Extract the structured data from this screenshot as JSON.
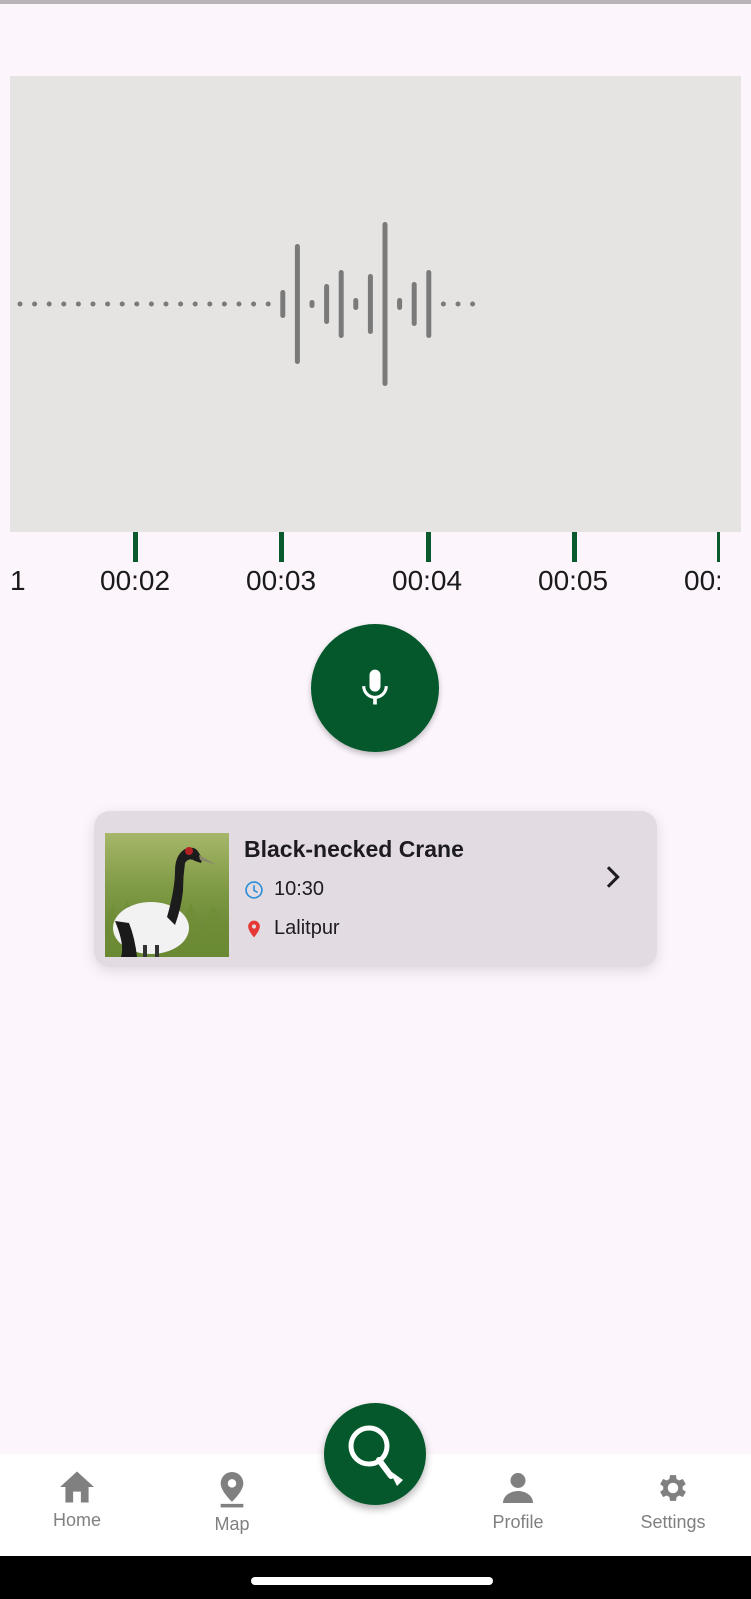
{
  "waveform": {
    "bars": [
      2,
      2,
      2,
      2,
      2,
      2,
      2,
      2,
      2,
      2,
      2,
      2,
      2,
      2,
      2,
      2,
      2,
      2,
      14,
      60,
      4,
      20,
      34,
      6,
      30,
      82,
      6,
      22,
      34,
      2,
      2,
      2
    ]
  },
  "timeline": {
    "labels": [
      "1",
      "00:02",
      "00:03",
      "00:04",
      "00:05",
      "00:"
    ]
  },
  "record_button": {
    "icon": "microphone-icon"
  },
  "result": {
    "name": "Black-necked Crane",
    "time": "10:30",
    "location": "Lalitpur",
    "time_icon": "clock-icon",
    "location_icon": "location-pin-icon",
    "action_icon": "chevron-right-icon"
  },
  "nav": {
    "items": [
      {
        "label": "Home",
        "icon": "home-icon"
      },
      {
        "label": "Map",
        "icon": "map-pin-icon"
      },
      {
        "label": "Profile",
        "icon": "person-icon"
      },
      {
        "label": "Settings",
        "icon": "gear-icon"
      }
    ],
    "center_icon": "search-icon",
    "inactive_color": "#808080"
  },
  "colors": {
    "accent": "#05582b",
    "background": "#fcf6fc",
    "waveform": "#7a7a7a",
    "card": "#e2dce2"
  }
}
